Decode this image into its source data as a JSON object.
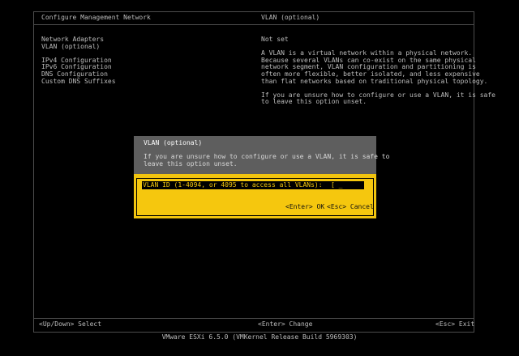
{
  "header": {
    "left_title": "Configure Management Network",
    "right_title": "VLAN (optional)"
  },
  "menu": {
    "items": [
      "Network Adapters",
      "VLAN (optional)",
      "",
      "IPv4 Configuration",
      "IPv6 Configuration",
      "DNS Configuration",
      "Custom DNS Suffixes"
    ]
  },
  "details": {
    "status": "Not set",
    "description": [
      "A VLAN is a virtual network within a physical network.",
      "Because several VLANs can co-exist on the same physical",
      "network segment, VLAN configuration and partitioning is",
      "often more flexible, better isolated, and less expensive",
      "than flat networks based on traditional physical topology."
    ],
    "hint": [
      "If you are unsure how to configure or use a VLAN, it is safe",
      "to leave this option unset."
    ]
  },
  "footer": {
    "left": "<Up/Down> Select",
    "middle": "<Enter> Change",
    "right": "<Esc> Exit",
    "build": "VMware ESXi 6.5.0 (VMKernel Release Build 5969303)"
  },
  "dialog": {
    "title": "VLAN (optional)",
    "message": [
      "If you are unsure how to configure or use a VLAN, it is safe to",
      "leave this option unset."
    ],
    "field_label": "VLAN ID (1-4094, or 4095 to access all VLANs):",
    "field_value": "[ _      ]",
    "ok_label": "<Enter> OK",
    "cancel_label": "<Esc> Cancel"
  },
  "colors": {
    "background": "#000000",
    "text": "#bdbdbd",
    "dialog_accent": "#f1c40f",
    "dialog_header": "#5e5e5e"
  }
}
